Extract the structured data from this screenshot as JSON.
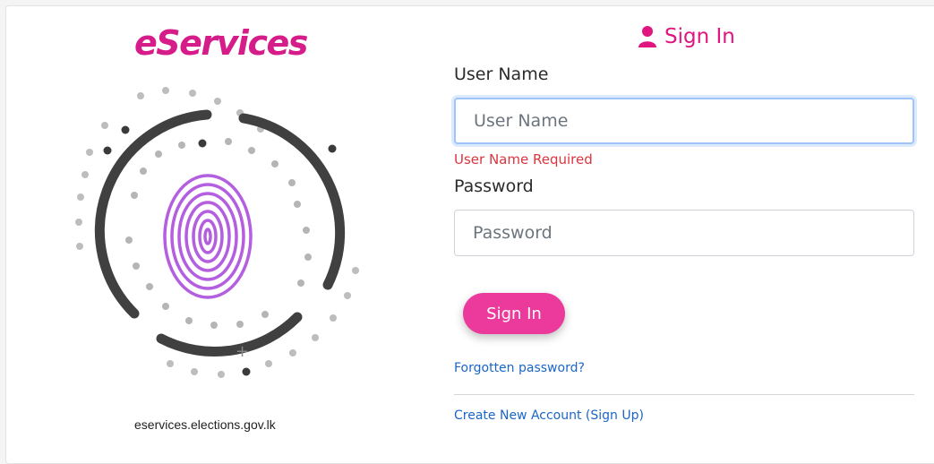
{
  "brand": {
    "logo_text": "eServices",
    "site_url": "eservices.elections.gov.lk",
    "accent_color": "#e0157f"
  },
  "signin": {
    "title": "Sign In",
    "icon": "user-icon"
  },
  "form": {
    "username_label": "User Name",
    "username_placeholder": "User Name",
    "username_value": "",
    "username_error": "User Name Required",
    "password_label": "Password",
    "password_placeholder": "Password",
    "password_value": "",
    "submit_label": "Sign In"
  },
  "links": {
    "forgot_password": "Forgotten password?",
    "create_account": "Create New Account (Sign Up)"
  }
}
